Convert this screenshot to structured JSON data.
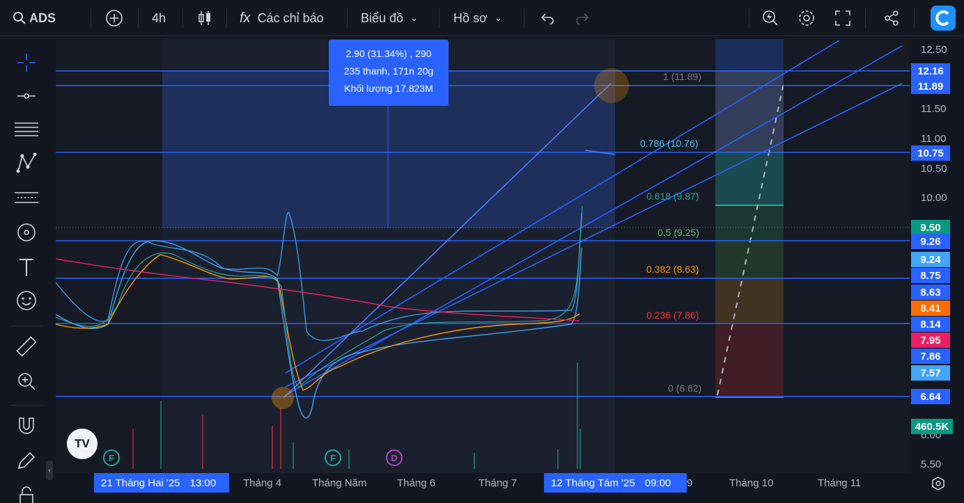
{
  "toolbar": {
    "symbol": "ADS",
    "interval": "4h",
    "indicators_label": "Các chỉ báo",
    "chart_label": "Biểu đồ",
    "profile_label": "Hồ sơ"
  },
  "price_axis": {
    "ticks": [
      "12.50",
      "11.50",
      "11.00",
      "10.50",
      "10.00",
      "6.00",
      "5.50"
    ],
    "badges": [
      "12.16",
      "11.89",
      "10.75",
      "9.50",
      "9.26",
      "9.24",
      "8.75",
      "8.63",
      "8.41",
      "8.14",
      "7.95",
      "7.86",
      "7.57",
      "6.64",
      "460.5K"
    ]
  },
  "time_axis": {
    "start_badge": "21 Tháng Hai '25",
    "start_time": "13:00",
    "labels": [
      "Tháng 4",
      "Tháng Năm",
      "Tháng 6",
      "Tháng 7",
      "Tháng 10",
      "Tháng 11"
    ],
    "cursor_badge": "12 Tháng Tám '25",
    "cursor_time": "09:00",
    "cut_label": "9"
  },
  "tooltip": {
    "line1": "2.90 (31.34%) , 290",
    "line2": "235 thanh, 171n 20g",
    "line3": "Khối lượng 17.823M"
  },
  "fib_levels": [
    {
      "label": "1 (11.89)",
      "color": "#787b86"
    },
    {
      "label": "0.786 (10.76)",
      "color": "#4fc3f7"
    },
    {
      "label": "0.618 (9.87)",
      "color": "#26a69a"
    },
    {
      "label": "0.5 (9.25)",
      "color": "#66bb6a"
    },
    {
      "label": "0.382 (8.63)",
      "color": "#ff9800"
    },
    {
      "label": "0.236 (7.86)",
      "color": "#f23645"
    },
    {
      "label": "0 (6.62)",
      "color": "#787b86"
    }
  ],
  "events": [
    "F",
    "F",
    "D"
  ],
  "logo_text": "TV"
}
